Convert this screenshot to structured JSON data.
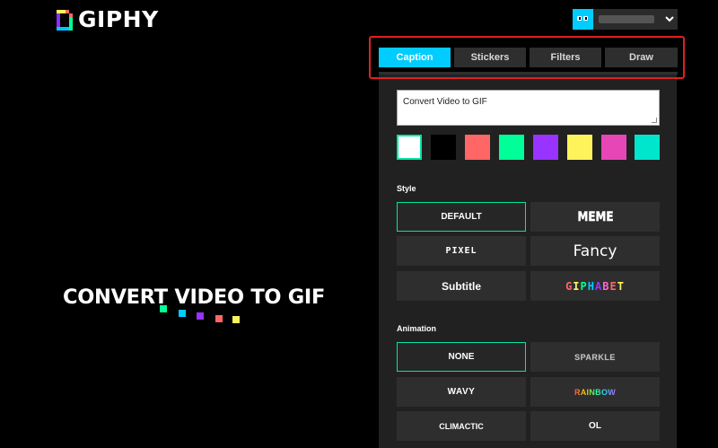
{
  "header": {
    "logo_text": "GIPHY",
    "user_chevron": "⌄"
  },
  "hero": {
    "title": "CONVERT VIDEO TO GIF",
    "loader_colors": [
      "#00ff99",
      "#00ccff",
      "#9933ff",
      "#ff6666",
      "#fff35c"
    ]
  },
  "tabs": [
    {
      "label": "Caption",
      "active": true
    },
    {
      "label": "Stickers",
      "active": false
    },
    {
      "label": "Filters",
      "active": false
    },
    {
      "label": "Draw",
      "active": false
    }
  ],
  "caption": {
    "value": "Convert Video to GIF"
  },
  "colors": {
    "swatches": [
      "#ffffff",
      "#000000",
      "#ff6666",
      "#00ff99",
      "#9933ff",
      "#fff35c",
      "#e646b6",
      "#00e6cc"
    ],
    "selected_index": 0,
    "accent": "#00ccff",
    "selection_border": "#00e6a0"
  },
  "style": {
    "label": "Style",
    "options": [
      {
        "label": "DEFAULT",
        "selected": true
      },
      {
        "label": "MEME",
        "selected": false
      },
      {
        "label": "PIXEL",
        "selected": false
      },
      {
        "label": "Fancy",
        "selected": false
      },
      {
        "label": "Subtitle",
        "selected": false
      },
      {
        "label": "GIPHABET",
        "selected": false
      }
    ]
  },
  "animation": {
    "label": "Animation",
    "options": [
      {
        "label": "NONE",
        "selected": true
      },
      {
        "label": "SPARKLE",
        "selected": false
      },
      {
        "label": "WAVY",
        "selected": false
      },
      {
        "label": "RAINBOW",
        "selected": false
      },
      {
        "label": "CLIMACTIC",
        "selected": false
      },
      {
        "label": "OL",
        "selected": false
      }
    ]
  }
}
